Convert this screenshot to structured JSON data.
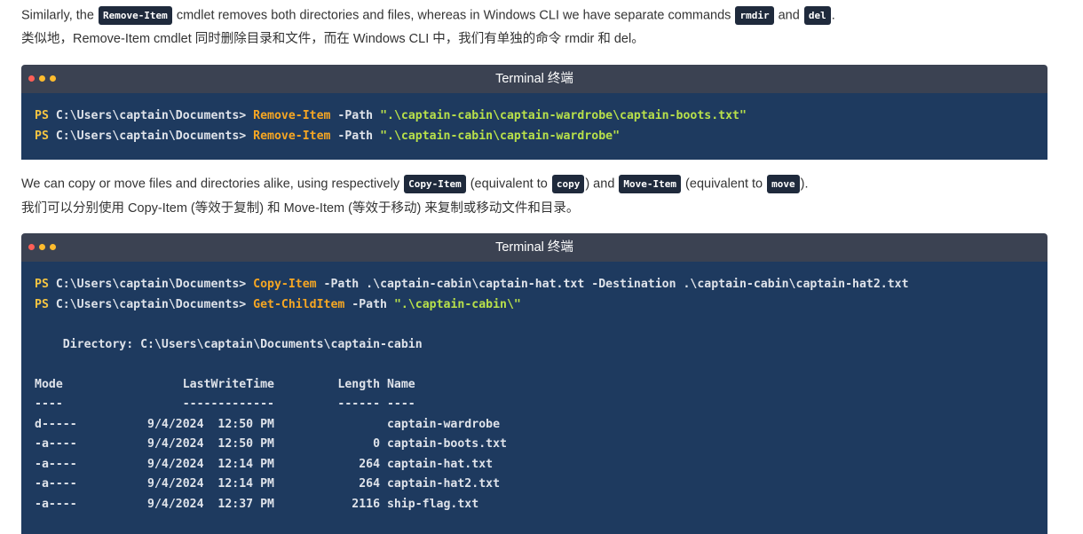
{
  "para1": {
    "en_before": "Similarly, the ",
    "chip_remove": "Remove-Item",
    "en_mid": " cmdlet removes both directories and files, whereas in Windows CLI we have separate commands ",
    "chip_rmdir": "rmdir",
    "en_and": " and ",
    "chip_del": "del",
    "en_end": ".",
    "zh": "类似地，Remove-Item cmdlet 同时删除目录和文件，而在 Windows CLI 中，我们有单独的命令 rmdir 和 del。"
  },
  "terminal1": {
    "title": "Terminal  终端",
    "lines": [
      {
        "ps": "PS",
        "path": " C:\\Users\\captain\\Documents> ",
        "cmd": "Remove-Item",
        "param": " -Path ",
        "str": "\".\\captain-cabin\\captain-wardrobe\\captain-boots.txt\""
      },
      {
        "ps": "PS",
        "path": " C:\\Users\\captain\\Documents> ",
        "cmd": "Remove-Item",
        "param": " -Path ",
        "str": "\".\\captain-cabin\\captain-wardrobe\""
      }
    ]
  },
  "para2": {
    "en_before": "We can copy or move files and directories alike, using respectively ",
    "chip_copyitem": "Copy-Item",
    "en_eq1": " (equivalent to ",
    "chip_copy": "copy",
    "en_and": ") and ",
    "chip_moveitem": "Move-Item",
    "en_eq2": " (equivalent to ",
    "chip_move": "move",
    "en_end": ").",
    "zh": "我们可以分别使用 Copy-Item (等效于复制) 和 Move-Item (等效于移动) 来复制或移动文件和目录。"
  },
  "terminal2": {
    "title": "Terminal  终端",
    "cmd1": {
      "ps": "PS",
      "path": " C:\\Users\\captain\\Documents> ",
      "cmd": "Copy-Item",
      "rest": " -Path .\\captain-cabin\\captain-hat.txt -Destination .\\captain-cabin\\captain-hat2.txt"
    },
    "cmd2": {
      "ps": "PS",
      "path": " C:\\Users\\captain\\Documents> ",
      "cmd": "Get-ChildItem",
      "param": " -Path ",
      "str": "\".\\captain-cabin\\\""
    },
    "directory": "    Directory: C:\\Users\\captain\\Documents\\captain-cabin",
    "header": "Mode                 LastWriteTime         Length Name",
    "separator": "----                 -------------         ------ ----",
    "rows": [
      "d-----          9/4/2024  12:50 PM                captain-wardrobe",
      "-a----          9/4/2024  12:50 PM              0 captain-boots.txt",
      "-a----          9/4/2024  12:14 PM            264 captain-hat.txt",
      "-a----          9/4/2024  12:14 PM            264 captain-hat2.txt",
      "-a----          9/4/2024  12:37 PM           2116 ship-flag.txt"
    ]
  }
}
